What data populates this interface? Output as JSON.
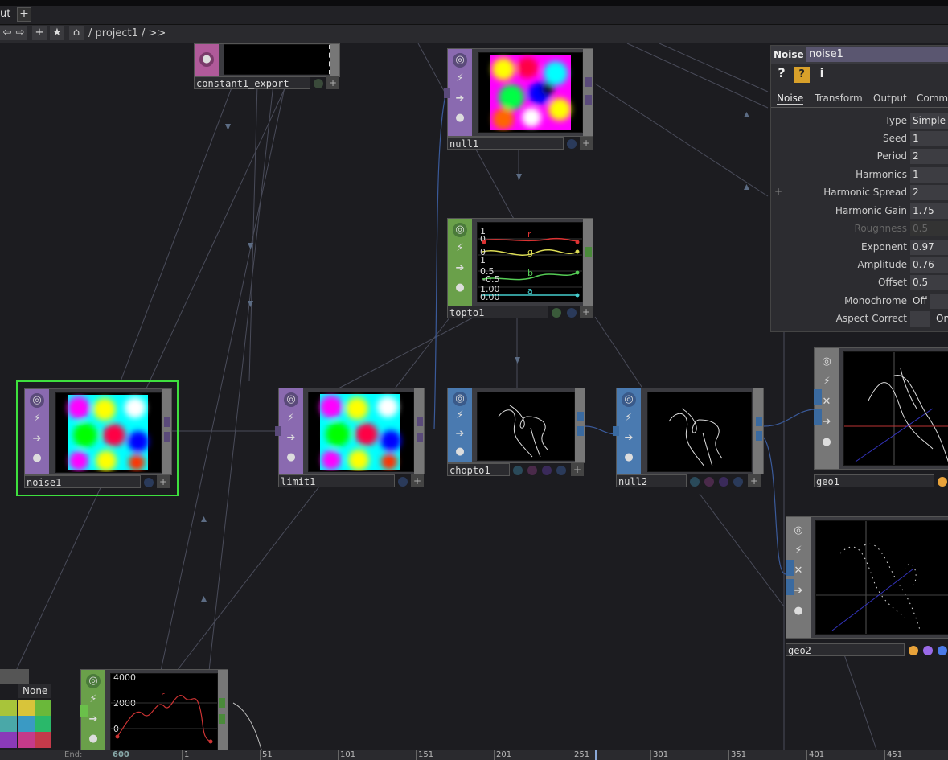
{
  "tab": {
    "label": "ut",
    "add": "+"
  },
  "path": {
    "text": "/ project1 / >>",
    "buttons": [
      "⇦",
      "⇨",
      "+",
      "★",
      "⌂"
    ]
  },
  "nodes": {
    "constant1_export": {
      "name": "constant1_export"
    },
    "null1": {
      "name": "null1"
    },
    "topto1": {
      "name": "topto1",
      "labels": {
        "r": "r",
        "g": "g",
        "b": "b",
        "a": "a"
      },
      "ticks": [
        "1",
        "0",
        "0",
        "1",
        "0.5",
        "-0.5",
        "1.00",
        "0.00"
      ]
    },
    "noise1": {
      "name": "noise1"
    },
    "limit1": {
      "name": "limit1"
    },
    "chopto1": {
      "name": "chopto1"
    },
    "null2": {
      "name": "null2"
    },
    "geo1": {
      "name": "geo1"
    },
    "geo2": {
      "name": "geo2"
    },
    "chart": {
      "ticks": [
        "4000",
        "2000",
        "0"
      ],
      "series_label": "r"
    }
  },
  "swatch": {
    "label": "None"
  },
  "param": {
    "op_type": "Noise",
    "op_name": "noise1",
    "icons": [
      "?",
      "?",
      "i"
    ],
    "tabs": [
      "Noise",
      "Transform",
      "Output",
      "Comm"
    ],
    "rows": [
      {
        "label": "Type",
        "value": "Simple"
      },
      {
        "label": "Seed",
        "value": "1"
      },
      {
        "label": "Period",
        "value": "2"
      },
      {
        "label": "Harmonics",
        "value": "1"
      },
      {
        "label": "Harmonic Spread",
        "value": "2"
      },
      {
        "label": "Harmonic Gain",
        "value": "1.75"
      },
      {
        "label": "Roughness",
        "value": "0.5"
      },
      {
        "label": "Exponent",
        "value": "0.97"
      },
      {
        "label": "Amplitude",
        "value": "0.76"
      },
      {
        "label": "Offset",
        "value": "0.5"
      },
      {
        "label": "Monochrome",
        "value": "Off"
      },
      {
        "label": "Aspect Correct",
        "value": "On"
      }
    ],
    "plus": "+"
  },
  "timeline": {
    "end_label": "End:",
    "end_value": "600",
    "ticks": [
      "1",
      "51",
      "101",
      "151",
      "201",
      "251",
      "301",
      "351",
      "401",
      "451"
    ]
  },
  "colors": {
    "top": "#8a6ab0",
    "chop": "#6aa04a",
    "sop": "#4a7ab0",
    "mat": "#b05a9a",
    "selected": "#3ee03e"
  }
}
